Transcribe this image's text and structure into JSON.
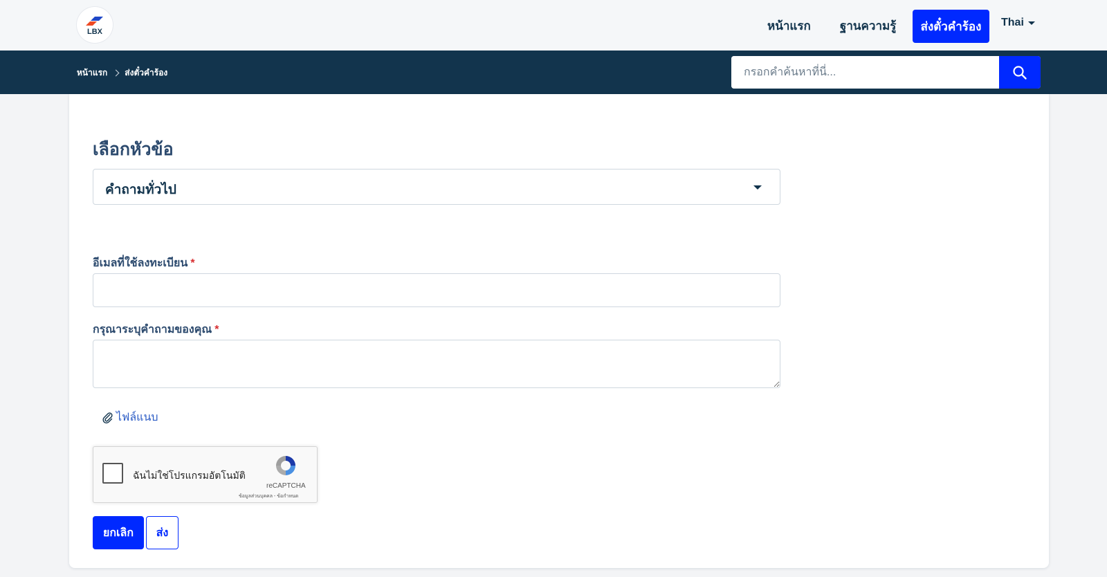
{
  "header": {
    "logo_text": "LBX",
    "nav": {
      "home": "หน้าแรก",
      "knowledge_base": "ฐานความรู้",
      "submit_ticket": "ส่งตั๋วคำร้อง",
      "language": "Thai"
    }
  },
  "subheader": {
    "breadcrumb": [
      "หน้าแรก",
      "ส่งตั๋วคำร้อง"
    ],
    "search": {
      "placeholder": "กรอกคำค้นหาที่นี่..."
    }
  },
  "form": {
    "topic_title": "เลือกหัวข้อ",
    "topic_selected": "คำถามทั่วไป",
    "email_label": "อีเมลที่ใช้ลงทะเบียน",
    "email_value": "",
    "question_label": "กรุณาระบุคำถามของคุณ",
    "question_value": "",
    "required_mark": "*",
    "attachment_label": "ไฟล์แนบ",
    "recaptcha": {
      "label": "ฉันไม่ใช่โปรแกรมอัตโนมัติ",
      "brand": "reCAPTCHA",
      "links": "ข้อมูลส่วนบุคคล - ข้อกำหนด"
    },
    "cancel_label": "ยกเลิก",
    "submit_label": "ส่ง"
  },
  "colors": {
    "primary": "#0029ff",
    "navy": "#12344d",
    "required": "#d72d30",
    "link": "#2c5cc5"
  }
}
